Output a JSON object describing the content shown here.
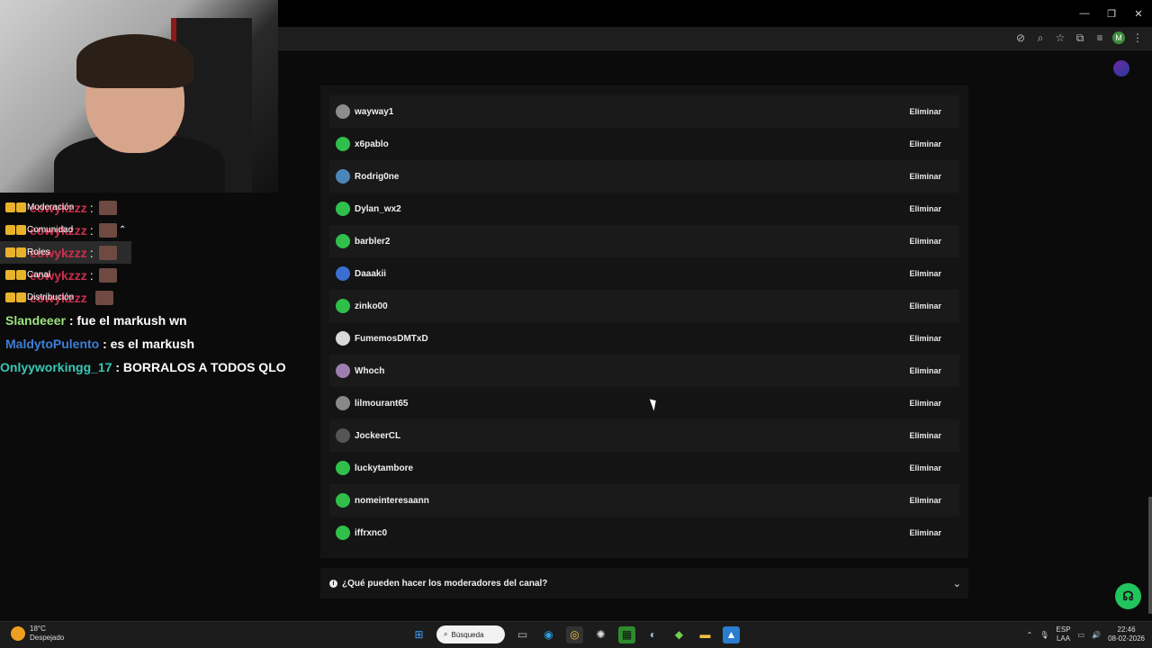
{
  "window": {
    "minimize": "—",
    "restore": "❐",
    "close": "✕"
  },
  "addressbar": {
    "icons": [
      "camera-off-icon",
      "zoom-icon",
      "star-icon",
      "extensions-icon",
      "menu-list-icon"
    ],
    "profile_initial": "M"
  },
  "chat_menu": [
    {
      "label": "Moderación",
      "user": "eowykzzz",
      "sep": ":"
    },
    {
      "label": "Comunidad",
      "user": "eowykzzz",
      "sep": ":"
    },
    {
      "label": "Roles",
      "user": "eowykzzz",
      "sep": ":"
    },
    {
      "label": "Canal",
      "user": "eowykzzz",
      "sep": ":"
    },
    {
      "label": "Distribución",
      "user": "eowykzzz",
      "sep": ""
    }
  ],
  "chat_messages": [
    {
      "user": "Slandeeer",
      "user_color": "#9be37c",
      "message": ": fue el markush wn"
    },
    {
      "user": "MaldytoPulento",
      "user_color": "#3d7fd8",
      "message": ": es el markush"
    },
    {
      "user": "Onlyyworkingg_17",
      "user_color": "#38c9b6",
      "message": ": BORRALOS A TODOS QLO"
    }
  ],
  "moderators": {
    "delete_label": "Eliminar",
    "rows": [
      {
        "name": "wayway1",
        "avatar_color": "#8c8c8c"
      },
      {
        "name": "x6pablo",
        "avatar_color": "#2fbf4a"
      },
      {
        "name": "Rodrig0ne",
        "avatar_color": "#4a86b8"
      },
      {
        "name": "Dylan_wx2",
        "avatar_color": "#2fbf4a"
      },
      {
        "name": "barbler2",
        "avatar_color": "#2fbf4a"
      },
      {
        "name": "Daaakii",
        "avatar_color": "#3a6fd0"
      },
      {
        "name": "zinko00",
        "avatar_color": "#2fbf4a"
      },
      {
        "name": "FumemosDMTxD",
        "avatar_color": "#d9d9d9"
      },
      {
        "name": "Whoch",
        "avatar_color": "#9c7fb0"
      },
      {
        "name": "lilmourant65",
        "avatar_color": "#888888"
      },
      {
        "name": "JockeerCL",
        "avatar_color": "#555555"
      },
      {
        "name": "luckytambore",
        "avatar_color": "#2fbf4a"
      },
      {
        "name": "nomeinteresaann",
        "avatar_color": "#2fbf4a"
      },
      {
        "name": "iffrxnc0",
        "avatar_color": "#2fbf4a"
      }
    ]
  },
  "faq": {
    "question": "¿Qué pueden hacer los moderadores del canal?"
  },
  "taskbar": {
    "weather_temp": "18°C",
    "weather_desc": "Despejado",
    "search_label": "Búsqueda",
    "lang_top": "ESP",
    "lang_bottom": "LAA",
    "time": "22:46",
    "date": "08-02-2026"
  }
}
